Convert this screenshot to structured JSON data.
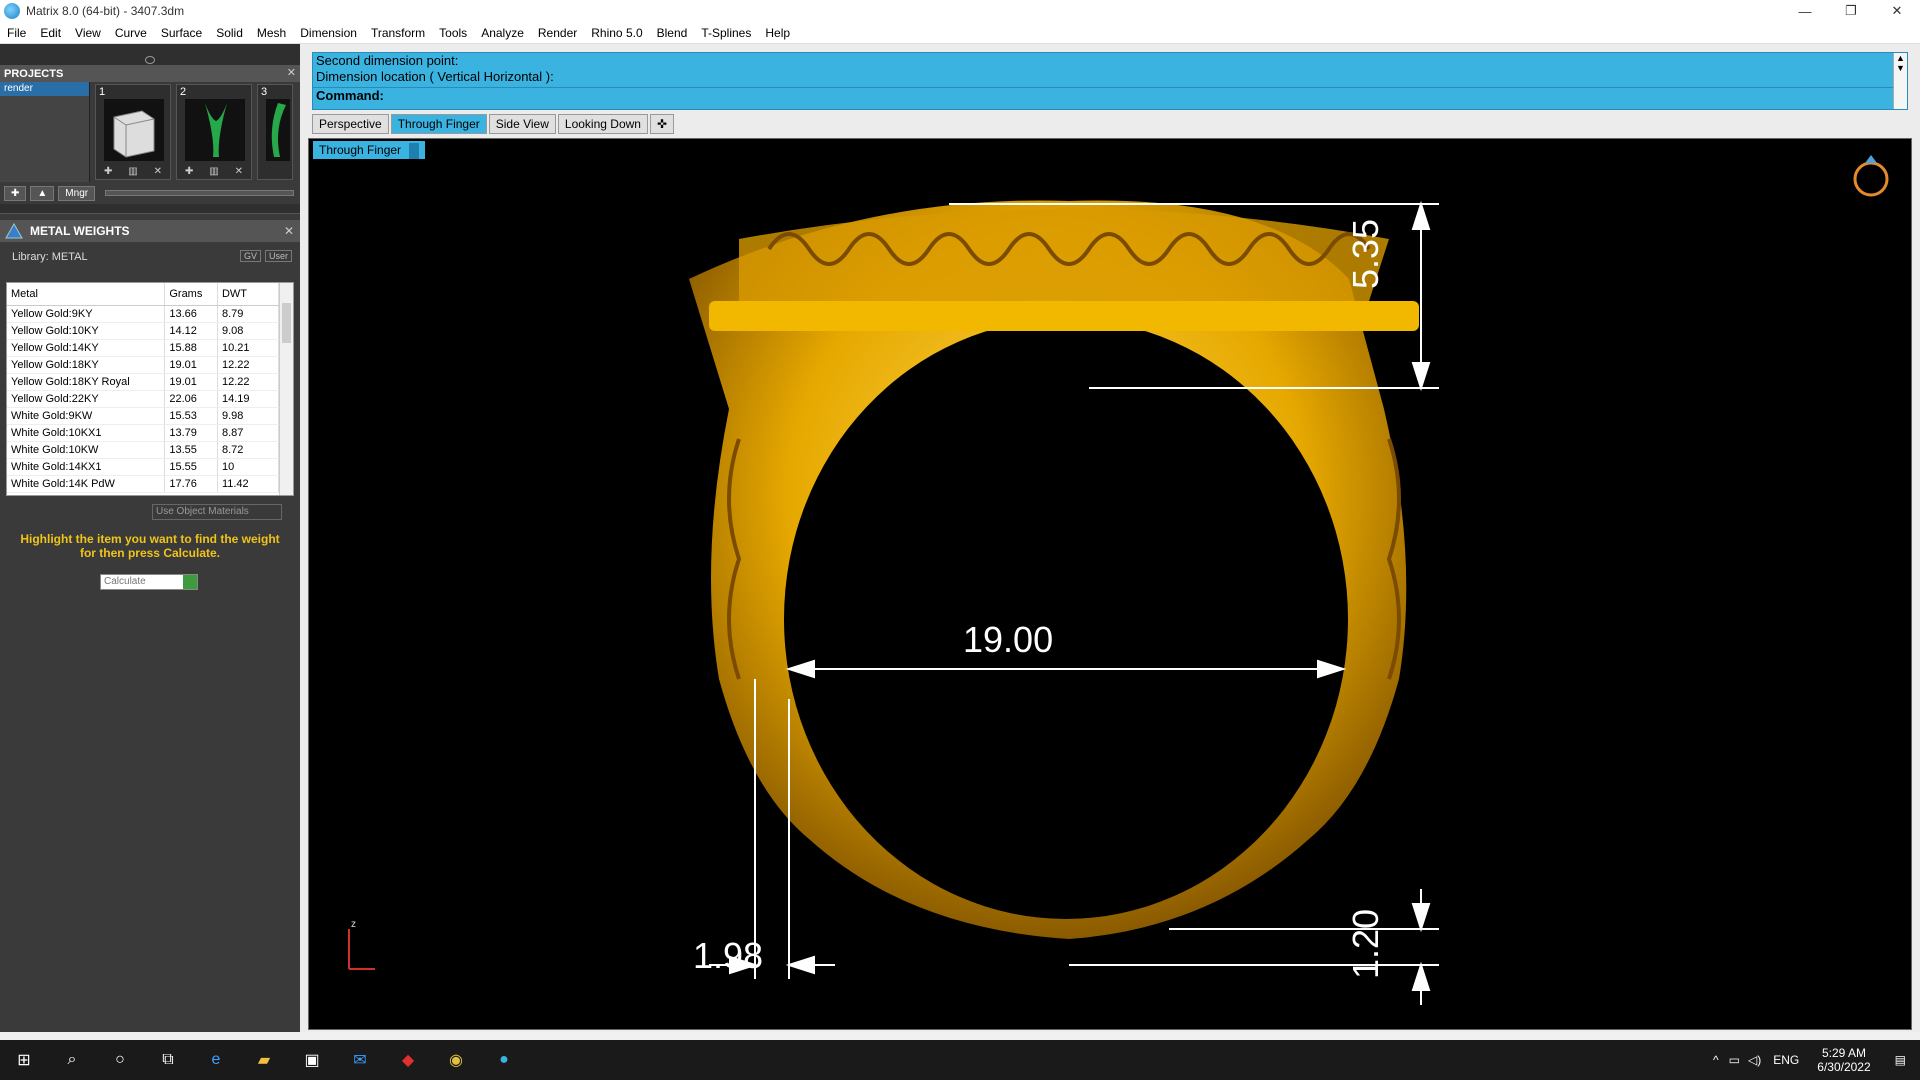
{
  "window": {
    "title": "Matrix 8.0 (64-bit) - 3407.3dm",
    "controls": [
      "—",
      "❐",
      "✕"
    ]
  },
  "menu": [
    "File",
    "Edit",
    "View",
    "Curve",
    "Surface",
    "Solid",
    "Mesh",
    "Dimension",
    "Transform",
    "Tools",
    "Analyze",
    "Render",
    "Rhino 5.0",
    "Blend",
    "T-Splines",
    "Help"
  ],
  "projects": {
    "title": "PROJECTS",
    "selected": "render",
    "thumb_numbers": [
      "1",
      "2",
      "3"
    ],
    "mngr": "Mngr"
  },
  "metal_weights": {
    "title": "METAL WEIGHTS",
    "library": "Library: METAL",
    "toggle_gv": "GV",
    "toggle_user": "User",
    "columns": [
      "Metal",
      "Grams",
      "DWT"
    ],
    "rows": [
      [
        "Yellow Gold:9KY",
        "13.66",
        "8.79"
      ],
      [
        "Yellow Gold:10KY",
        "14.12",
        "9.08"
      ],
      [
        "Yellow Gold:14KY",
        "15.88",
        "10.21"
      ],
      [
        "Yellow Gold:18KY",
        "19.01",
        "12.22"
      ],
      [
        "Yellow Gold:18KY Royal",
        "19.01",
        "12.22"
      ],
      [
        "Yellow Gold:22KY",
        "22.06",
        "14.19"
      ],
      [
        "White Gold:9KW",
        "15.53",
        "9.98"
      ],
      [
        "White Gold:10KX1",
        "13.79",
        "8.87"
      ],
      [
        "White Gold:10KW",
        "13.55",
        "8.72"
      ],
      [
        "White Gold:14KX1",
        "15.55",
        "10"
      ],
      [
        "White Gold:14K PdW",
        "17.76",
        "11.42"
      ]
    ],
    "use_object_materials": "Use Object Materials",
    "hint": "Highlight the item you want to find the weight for then press Calculate.",
    "calculate": "Calculate"
  },
  "command": {
    "line1": "Second dimension point:",
    "line2": "Dimension location ( Vertical  Horizontal ):",
    "prompt": "Command:"
  },
  "tabs": [
    "Perspective",
    "Through Finger",
    "Side View",
    "Looking Down"
  ],
  "viewport": {
    "label": "Through Finger",
    "dimensions": [
      "19.00",
      "5.35",
      "1.98",
      "1.20"
    ],
    "axis_label": "z"
  },
  "taskbar": {
    "lang": "ENG",
    "time": "5:29 AM",
    "date": "6/30/2022"
  }
}
